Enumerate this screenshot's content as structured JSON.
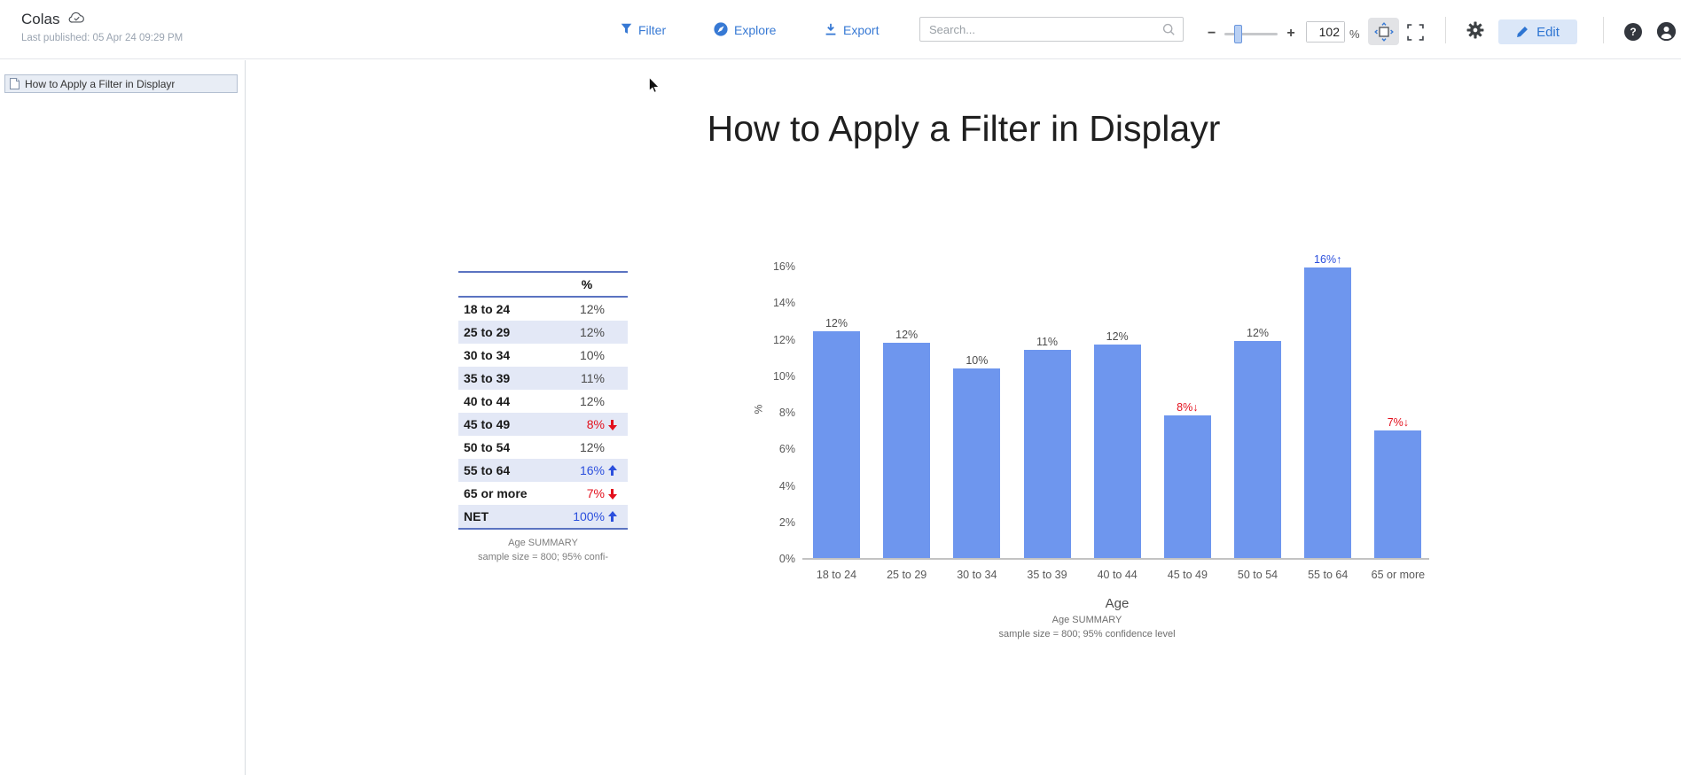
{
  "header": {
    "document_title": "Colas",
    "last_published": "Last published: 05 Apr 24 09:29 PM",
    "toolbar": {
      "filter_label": "Filter",
      "explore_label": "Explore",
      "export_label": "Export",
      "search_placeholder": "Search...",
      "zoom_value": "102",
      "zoom_unit": "%",
      "edit_label": "Edit",
      "help_glyph": "?"
    },
    "accent_color": "#3779d4"
  },
  "sidebar": {
    "pages": [
      {
        "label": "How to Apply a Filter in Displayr"
      }
    ]
  },
  "main": {
    "page_title": "How to Apply a Filter in Displayr",
    "table": {
      "value_header": "%",
      "rows": [
        {
          "label": "18 to 24",
          "value": "12%",
          "arrow": null,
          "color": null
        },
        {
          "label": "25 to 29",
          "value": "12%",
          "arrow": null,
          "color": null
        },
        {
          "label": "30 to 34",
          "value": "10%",
          "arrow": null,
          "color": null
        },
        {
          "label": "35 to 39",
          "value": "11%",
          "arrow": null,
          "color": null
        },
        {
          "label": "40 to 44",
          "value": "12%",
          "arrow": null,
          "color": null
        },
        {
          "label": "45 to 49",
          "value": "8%",
          "arrow": "down",
          "color": "#e3101d"
        },
        {
          "label": "50 to 54",
          "value": "12%",
          "arrow": null,
          "color": null
        },
        {
          "label": "55 to 64",
          "value": "16%",
          "arrow": "up",
          "color": "#2b4fdd"
        },
        {
          "label": "65 or more",
          "value": "7%",
          "arrow": "down",
          "color": "#e3101d"
        },
        {
          "label": "NET",
          "value": "100%",
          "arrow": "up",
          "color": "#2b4fdd"
        }
      ],
      "footnote_line1": "Age SUMMARY",
      "footnote_line2": "sample size = 800; 95% confi-"
    }
  },
  "chart_data": {
    "type": "bar",
    "title": "",
    "categories": [
      "18 to 24",
      "25 to 29",
      "30 to 34",
      "35 to 39",
      "40 to 44",
      "45 to 49",
      "50 to 54",
      "55 to 64",
      "65 or more"
    ],
    "values": [
      12,
      12,
      10,
      11,
      12,
      8,
      12,
      16,
      7
    ],
    "precise_values": [
      12.4,
      11.8,
      10.4,
      11.4,
      11.7,
      7.8,
      11.9,
      15.9,
      7.0
    ],
    "labels": [
      "12%",
      "12%",
      "10%",
      "11%",
      "12%",
      "8%↓",
      "12%",
      "16%↑",
      "7%↓"
    ],
    "label_colors": [
      "#4d4d4d",
      "#4d4d4d",
      "#4d4d4d",
      "#4d4d4d",
      "#4d4d4d",
      "#e3101d",
      "#4d4d4d",
      "#2b4fdd",
      "#e3101d"
    ],
    "xlabel": "Age",
    "ylabel": "%",
    "ylim": [
      0,
      16.6
    ],
    "yticks": [
      "0%",
      "2%",
      "4%",
      "6%",
      "8%",
      "10%",
      "12%",
      "14%",
      "16%"
    ],
    "bar_color": "#6e96ee",
    "grid": false,
    "legend": null,
    "footnote_line1": "Age SUMMARY",
    "footnote_line2": "sample size = 800; 95% confidence level"
  }
}
